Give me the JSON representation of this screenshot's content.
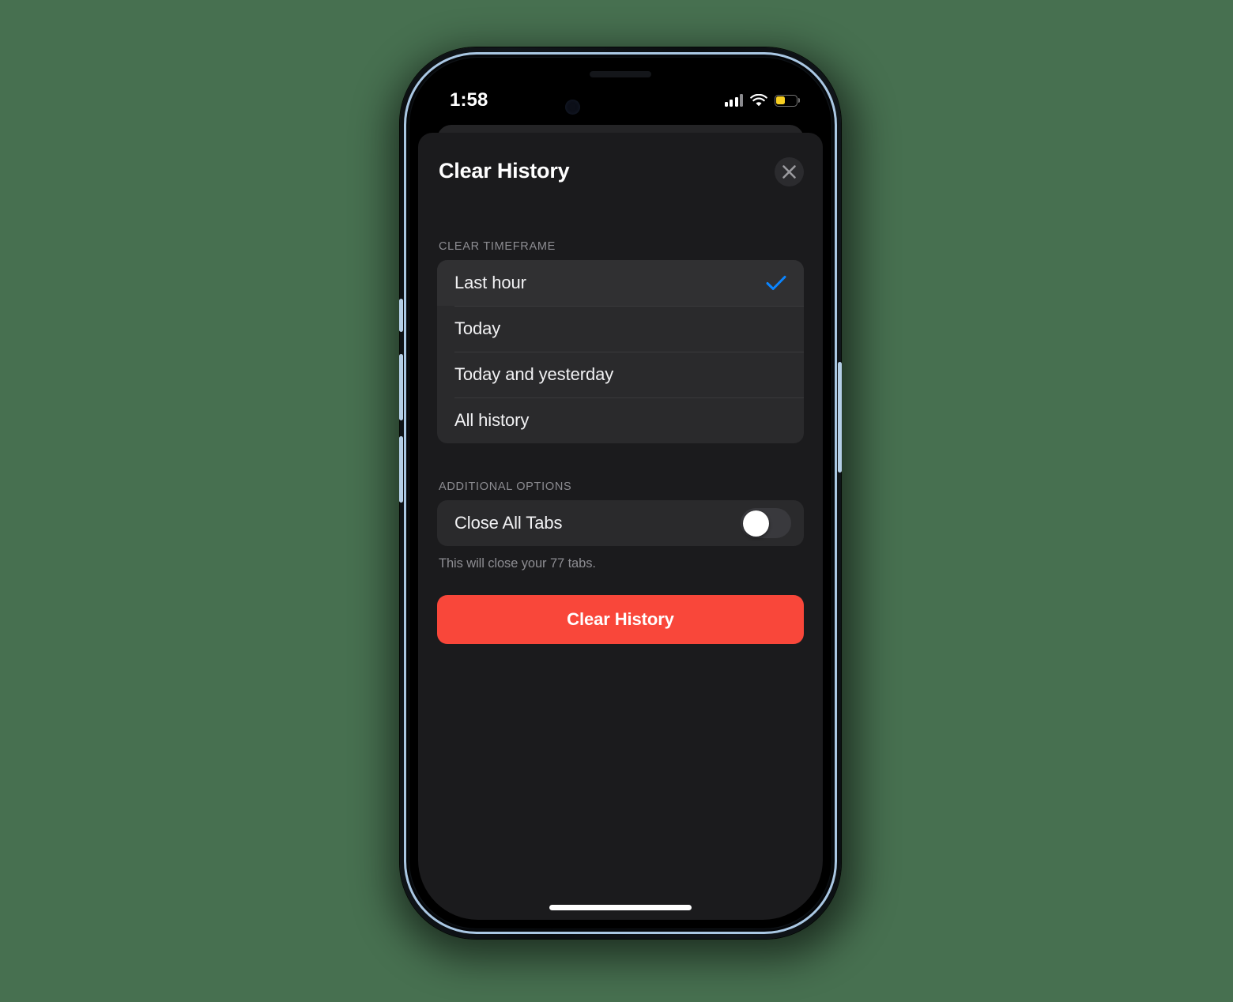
{
  "status_bar": {
    "time": "1:58",
    "signal_icon": "cellular-signal-icon",
    "signal_bars_total": 4,
    "signal_bars_filled": 3,
    "wifi_icon": "wifi-icon",
    "battery_icon": "battery-icon",
    "battery_percent": 42,
    "battery_color": "#f7cf21"
  },
  "sheet": {
    "title": "Clear History",
    "close_icon": "close-icon"
  },
  "timeframe": {
    "section_label": "CLEAR TIMEFRAME",
    "selected_index": 0,
    "check_icon": "checkmark-icon",
    "accent_color": "#0a84ff",
    "options": [
      {
        "label": "Last hour",
        "selected": true
      },
      {
        "label": "Today",
        "selected": false
      },
      {
        "label": "Today and yesterday",
        "selected": false
      },
      {
        "label": "All history",
        "selected": false
      }
    ]
  },
  "additional_options": {
    "section_label": "ADDITIONAL OPTIONS",
    "close_all_tabs": {
      "label": "Close All Tabs",
      "enabled": false,
      "footnote": "This will close your 77 tabs.",
      "tab_count": 77
    }
  },
  "primary_action": {
    "label": "Clear History",
    "color": "#f9473a"
  },
  "theme": {
    "page_background": "#477050",
    "sheet_background": "#1b1b1d",
    "card_background": "#2a2a2c",
    "selected_row_background": "#303032",
    "divider": "#3a3a3c",
    "primary_text": "#f2f2f4",
    "secondary_text": "#8d8d92",
    "device_rail": "#aac8e4"
  }
}
